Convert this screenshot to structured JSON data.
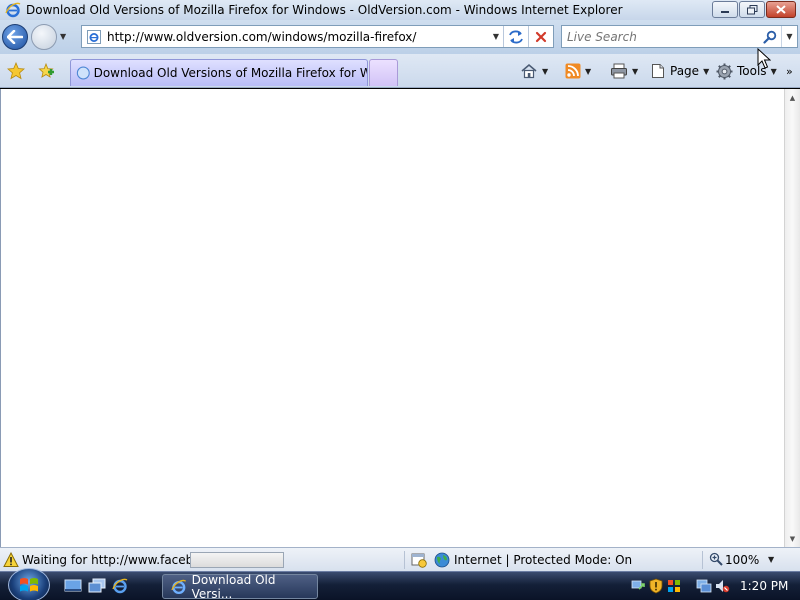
{
  "window": {
    "title": "Download Old Versions of Mozilla Firefox for Windows - OldVersion.com - Windows Internet Explorer",
    "app_icon": "ie-icon",
    "controls": {
      "minimize": "minimize-icon",
      "restore": "restore-icon",
      "close": "close-icon"
    }
  },
  "address_bar": {
    "url": "http://www.oldversion.com/windows/mozilla-firefox/",
    "dropdown_glyph": "▼"
  },
  "search": {
    "placeholder": "Live Search",
    "value": ""
  },
  "tabs": {
    "active_label": "Download Old Versions of Mozilla Firefox for Win..."
  },
  "command_bar": {
    "page_label": "Page",
    "tools_label": "Tools",
    "more_glyph": "»"
  },
  "status_bar": {
    "message": "Waiting for http://www.facebo",
    "progress": 0.0,
    "zone": "Internet | Protected Mode: On",
    "zoom": "100%"
  },
  "taskbar": {
    "task_label": "Download Old Versi...",
    "clock": "1:20 PM"
  },
  "colors": {
    "title_bar": "#cfdcec",
    "tab_active": "#c9ccfa",
    "taskbar": "#142038",
    "content": "#ffffff"
  }
}
